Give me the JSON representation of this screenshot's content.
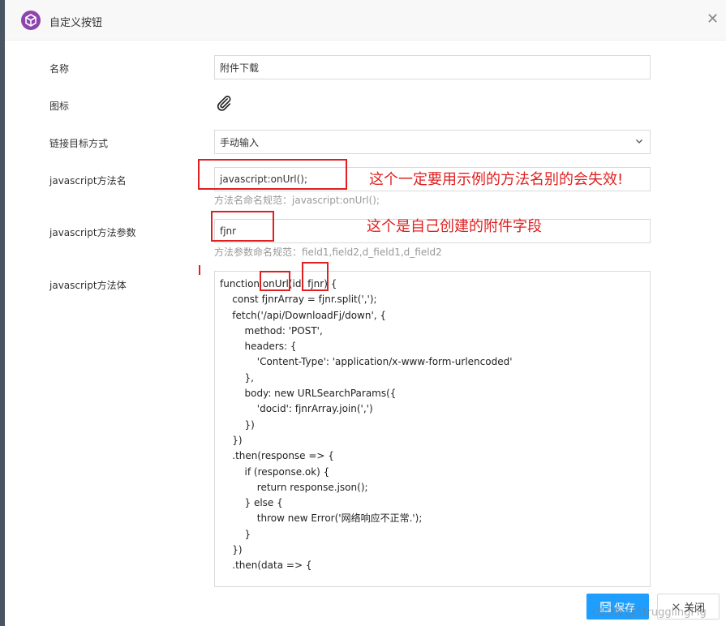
{
  "dialog": {
    "title": "自定义按钮",
    "close_glyph": "✕"
  },
  "form": {
    "name": {
      "label": "名称",
      "value": "附件下载"
    },
    "icon": {
      "label": "图标",
      "icon": "paperclip-icon"
    },
    "link_target": {
      "label": "链接目标方式",
      "value": "手动输入"
    },
    "js_method_name": {
      "label": "javascript方法名",
      "value": "javascript:onUrl();",
      "hint": "方法名命名规范：javascript:onUrl();"
    },
    "js_method_params": {
      "label": "javascript方法参数",
      "value": "fjnr",
      "hint": "方法参数命名规范：field1,field2,d_field1,d_field2"
    },
    "js_method_body": {
      "label": "javascript方法体",
      "lines": [
        "function onUrl(id, fjnr) {",
        "    const fjnrArray = fjnr.split(',');",
        "",
        "    fetch('/api/DownloadFj/down', {",
        "        method: 'POST',",
        "        headers: {",
        "            'Content-Type': 'application/x-www-form-urlencoded'",
        "        },",
        "        body: new URLSearchParams({",
        "            'docid': fjnrArray.join(',')",
        "        })",
        "    })",
        "    .then(response => {",
        "        if (response.ok) {",
        "            return response.json();",
        "        } else {",
        "            throw new Error('网络响应不正常.');",
        "        }",
        "    })",
        "    .then(data => {"
      ]
    }
  },
  "annotations": {
    "method_name_note": "这个一定要用示例的方法名别的会失效!",
    "params_note": "这个是自己创建的附件字段"
  },
  "footer": {
    "save_label": "保存",
    "close_label": "关闭"
  },
  "watermark": "CSDN @StrugglingPig",
  "colors": {
    "primary": "#1e9fff",
    "annotation_red": "#e02020",
    "logo_purple": "#8e44ad"
  }
}
